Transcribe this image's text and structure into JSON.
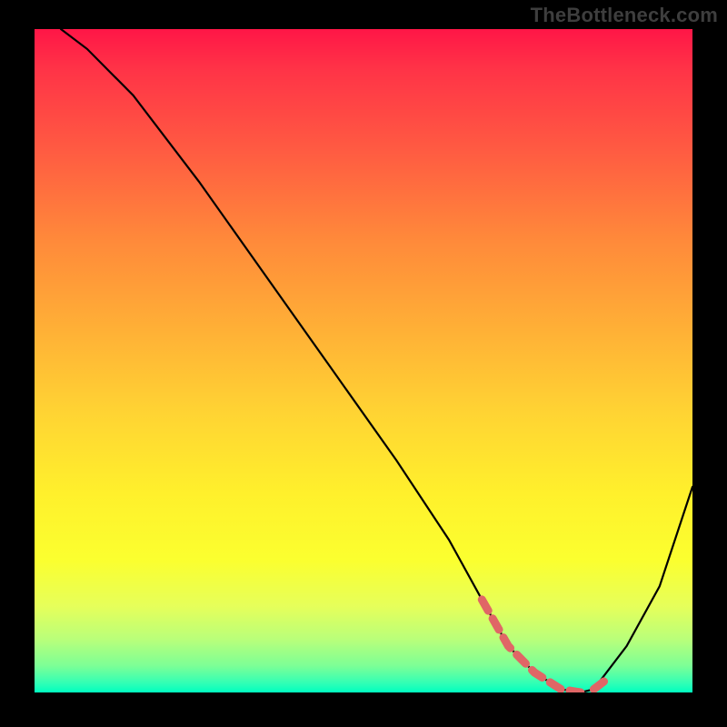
{
  "watermark": "TheBottleneck.com",
  "chart_data": {
    "type": "line",
    "title": "",
    "xlabel": "",
    "ylabel": "",
    "xlim": [
      0,
      100
    ],
    "ylim": [
      0,
      100
    ],
    "grid": false,
    "series": [
      {
        "name": "curve",
        "x": [
          4,
          8,
          15,
          25,
          35,
          45,
          55,
          63,
          68,
          72,
          76,
          80,
          83,
          85,
          90,
          95,
          100
        ],
        "y": [
          100,
          97,
          90,
          77,
          63,
          49,
          35,
          23,
          14,
          7,
          3,
          0.5,
          0,
          0.5,
          7,
          16,
          31
        ]
      }
    ],
    "highlight_segments": [
      {
        "name": "valley-left",
        "x": [
          68,
          72,
          76,
          80,
          83
        ],
        "y": [
          14,
          7,
          3,
          0.5,
          0
        ]
      },
      {
        "name": "valley-right",
        "x": [
          85,
          87
        ],
        "y": [
          0.5,
          2
        ]
      }
    ],
    "colors": {
      "curve": "#000000",
      "highlight": "#e06666",
      "gradient_top": "#ff1647",
      "gradient_bottom": "#00ffc0"
    }
  }
}
